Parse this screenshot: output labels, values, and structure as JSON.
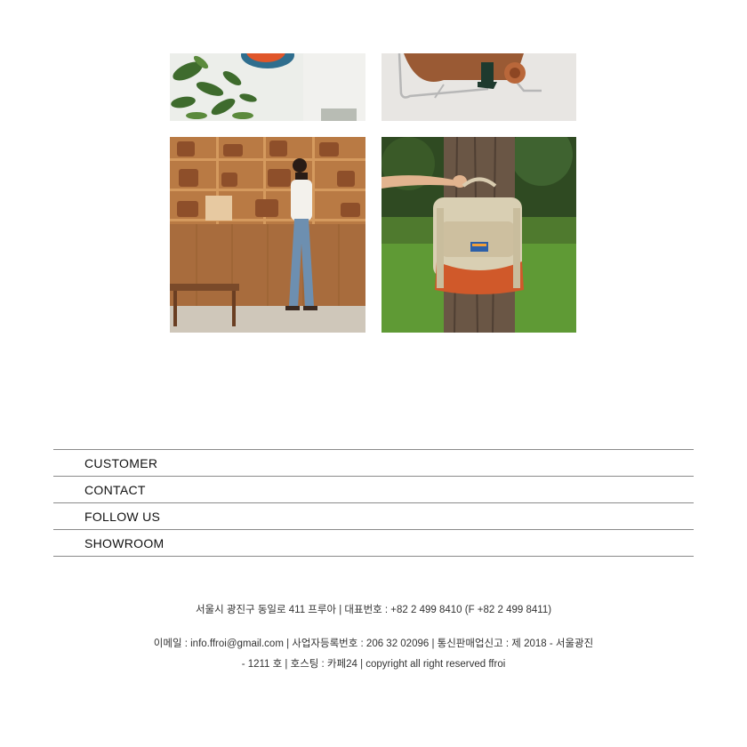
{
  "gallery": {
    "images": [
      {
        "name": "lifestyle-photo-plants-bag"
      },
      {
        "name": "lifestyle-photo-chair-bag"
      },
      {
        "name": "showroom-photo"
      },
      {
        "name": "backpack-forest-photo"
      }
    ]
  },
  "footer": {
    "menu": [
      {
        "label": "CUSTOMER"
      },
      {
        "label": "CONTACT"
      },
      {
        "label": "FOLLOW US"
      },
      {
        "label": "SHOWROOM"
      }
    ],
    "info_line1": "서울시 광진구 동일로 411 프루아 | 대표번호 : +82 2 499 8410 (F +82 2 499 8411)",
    "info_line2": "이메일 : info.ffroi@gmail.com | 사업자등록번호 : 206 32 02096 | 통신판매업신고 : 제 2018 - 서울광진",
    "info_line3": "- 1211 호 | 호스팅 : 카페24 | copyright all right reserved ffroi"
  },
  "colors": {
    "divider": "#8a8a8a",
    "text": "#111111",
    "muted_text": "#333333"
  }
}
